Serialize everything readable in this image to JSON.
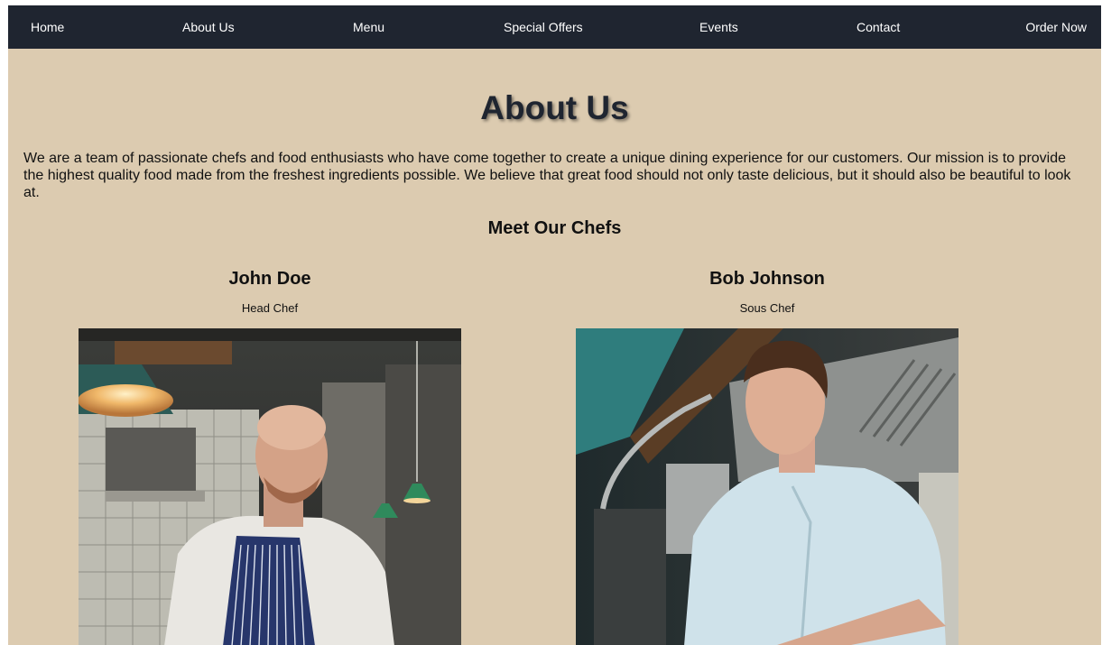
{
  "nav": {
    "home": "Home",
    "about": "About Us",
    "menu": "Menu",
    "offers": "Special Offers",
    "events": "Events",
    "contact": "Contact",
    "order": "Order Now"
  },
  "page": {
    "title": "About Us",
    "intro": "We are a team of passionate chefs and food enthusiasts who have come together to create a unique dining experience for our customers. Our mission is to provide the highest quality food made from the freshest ingredients possible. We believe that great food should not only taste delicious, but it should also be beautiful to look at.",
    "chefs_heading": "Meet Our Chefs"
  },
  "chefs": [
    {
      "name": "John Doe",
      "role": "Head Chef"
    },
    {
      "name": "Bob Johnson",
      "role": "Sous Chef"
    }
  ],
  "colors": {
    "nav_bg": "#1f2530",
    "page_bg": "#dccbb0",
    "title_color": "#1f2530"
  }
}
